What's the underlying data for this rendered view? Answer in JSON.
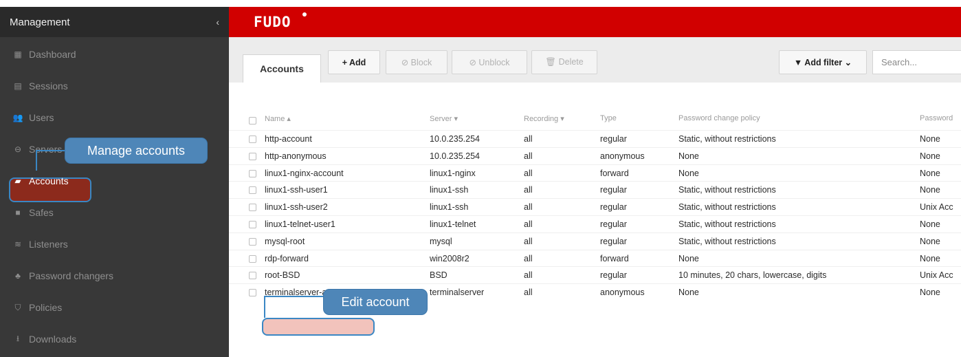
{
  "sidebar": {
    "title": "Management",
    "collapse_glyph": "‹",
    "items": [
      {
        "label": "Dashboard",
        "icon": "dashboard-icon",
        "glyph": "▦"
      },
      {
        "label": "Sessions",
        "icon": "sessions-icon",
        "glyph": "▤"
      },
      {
        "label": "Users",
        "icon": "users-icon",
        "glyph": "👥"
      },
      {
        "label": "Servers",
        "icon": "servers-icon",
        "glyph": "⊖"
      },
      {
        "label": "Accounts",
        "icon": "accounts-icon",
        "glyph": "▰"
      },
      {
        "label": "Safes",
        "icon": "safes-icon",
        "glyph": "■"
      },
      {
        "label": "Listeners",
        "icon": "listeners-icon",
        "glyph": "≋"
      },
      {
        "label": "Password changers",
        "icon": "password-changers-icon",
        "glyph": "♣"
      },
      {
        "label": "Policies",
        "icon": "policies-icon",
        "glyph": "⛉"
      },
      {
        "label": "Downloads",
        "icon": "downloads-icon",
        "glyph": "⭳"
      }
    ]
  },
  "topbar": {
    "logo": "FUDO"
  },
  "toolbar": {
    "tab": "Accounts",
    "add": "+ Add",
    "block": "⊘ Block",
    "unblock": "⊘ Unblock",
    "delete": "🗑 Delete",
    "add_filter": "▼ Add filter ⌄",
    "search_placeholder": "Search..."
  },
  "table": {
    "headers": [
      "Name ▴",
      "Server ▾",
      "Recording ▾",
      "Type",
      "Password change policy",
      "Password"
    ],
    "rows": [
      [
        "http-account",
        "10.0.235.254",
        "all",
        "regular",
        "Static, without restrictions",
        "None"
      ],
      [
        "http-anonymous",
        "10.0.235.254",
        "all",
        "anonymous",
        "None",
        "None"
      ],
      [
        "linux1-nginx-account",
        "linux1-nginx",
        "all",
        "forward",
        "None",
        "None"
      ],
      [
        "linux1-ssh-user1",
        "linux1-ssh",
        "all",
        "regular",
        "Static, without restrictions",
        "None"
      ],
      [
        "linux1-ssh-user2",
        "linux1-ssh",
        "all",
        "regular",
        "Static, without restrictions",
        "Unix Acc"
      ],
      [
        "linux1-telnet-user1",
        "linux1-telnet",
        "all",
        "regular",
        "Static, without restrictions",
        "None"
      ],
      [
        "mysql-root",
        "mysql",
        "all",
        "regular",
        "Static, without restrictions",
        "None"
      ],
      [
        "rdp-forward",
        "win2008r2",
        "all",
        "forward",
        "None",
        "None"
      ],
      [
        "root-BSD",
        "BSD",
        "all",
        "regular",
        "10 minutes, 20 chars, lowercase, digits",
        "Unix Acc"
      ],
      [
        "terminalserver-anonymous",
        "terminalserver",
        "all",
        "anonymous",
        "None",
        "None"
      ]
    ]
  },
  "callouts": {
    "manage": "Manage accounts",
    "edit": "Edit account"
  },
  "colors": {
    "brand": "#d10000",
    "callout": "#4e86b8",
    "sidebar": "#383838"
  }
}
